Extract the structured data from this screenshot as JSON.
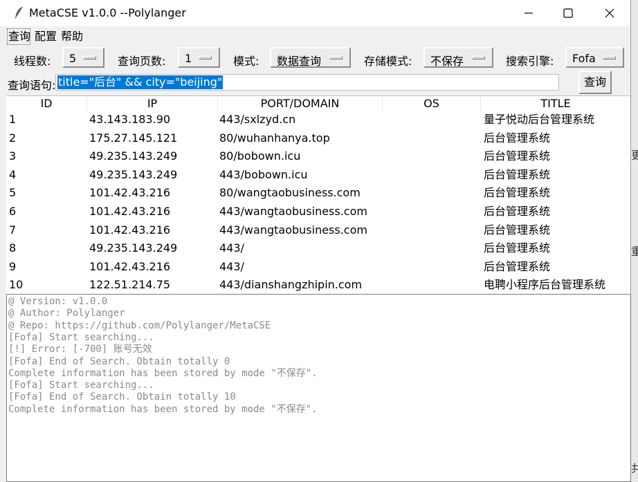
{
  "window": {
    "title": "MetaCSE v1.0.0  --Polylanger",
    "app_icon": "feather-icon",
    "controls": [
      "minimize-icon",
      "maximize-icon",
      "close-icon"
    ]
  },
  "menu": [
    "查询",
    "配置",
    "帮助"
  ],
  "toolbar": {
    "threads_label": "线程数:",
    "threads_value": "5",
    "pages_label": "查询页数:",
    "pages_value": "1",
    "mode_label": "模式:",
    "mode_value": "数据查询",
    "storage_label": "存储模式:",
    "storage_value": "不保存",
    "engine_label": "搜索引擎:",
    "engine_value": "Fofa"
  },
  "query": {
    "label": "查询语句:",
    "value": "title=\"后台\" && city=\"beijing\"",
    "button": "查询"
  },
  "table": {
    "columns": [
      "ID",
      "IP",
      "PORT/DOMAIN",
      "OS",
      "TITLE"
    ],
    "rows": [
      [
        "1",
        "43.143.183.90",
        "443/sxlzyd.cn",
        "",
        "量子悦动后台管理系统"
      ],
      [
        "2",
        "175.27.145.121",
        "80/wuhanhanya.top",
        "",
        "后台管理系统"
      ],
      [
        "3",
        "49.235.143.249",
        "80/bobown.icu",
        "",
        "后台管理系统"
      ],
      [
        "4",
        "49.235.143.249",
        "443/bobown.icu",
        "",
        "后台管理系统"
      ],
      [
        "5",
        "101.42.43.216",
        "80/wangtaobusiness.com",
        "",
        "后台管理系统"
      ],
      [
        "6",
        "101.42.43.216",
        "443/wangtaobusiness.com",
        "",
        "后台管理系统"
      ],
      [
        "7",
        "101.42.43.216",
        "443/wangtaobusiness.com",
        "",
        "后台管理系统"
      ],
      [
        "8",
        "49.235.143.249",
        "443/",
        "",
        "后台管理系统"
      ],
      [
        "9",
        "101.42.43.216",
        "443/",
        "",
        "后台管理系统"
      ],
      [
        "10",
        "122.51.214.75",
        "443/dianshangzhipin.com",
        "",
        "电聘小程序后台管理系统"
      ]
    ]
  },
  "console": [
    "@ Version: v1.0.0",
    "@ Author: Polylanger",
    "@ Repo: https://github.com/Polylanger/MetaCSE",
    "[Fofa] Start searching...",
    "[!] Error: [-700] 账号无效",
    "[Fofa] End of Search. Obtain totally 0",
    "Complete information has been stored by mode \"不保存\".",
    "[Fofa] Start searching...",
    "[Fofa] End of Search. Obtain totally 10",
    "Complete information has been stored by mode \"不保存\"."
  ],
  "background_window_glyphs": [
    "更",
    "重",
    "共"
  ]
}
